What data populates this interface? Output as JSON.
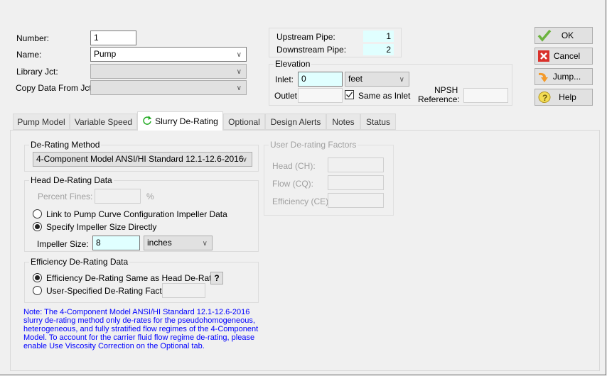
{
  "header": {
    "number_label": "Number:",
    "number_value": "1",
    "name_label": "Name:",
    "name_value": "Pump",
    "library_label": "Library Jct:",
    "copy_label": "Copy Data From Jct..."
  },
  "pipes": {
    "upstream_label": "Upstream Pipe:",
    "upstream_value": "1",
    "downstream_label": "Downstream Pipe:",
    "downstream_value": "2"
  },
  "elevation": {
    "title": "Elevation",
    "inlet_label": "Inlet:",
    "inlet_value": "0",
    "unit": "feet",
    "outlet_label": "Outlet:",
    "same_label": "Same as Inlet",
    "same_checked": true,
    "npsh_label1": "NPSH",
    "npsh_label2": "Reference:"
  },
  "buttons": {
    "ok": "OK",
    "cancel": "Cancel",
    "jump": "Jump...",
    "help": "Help"
  },
  "tabs": [
    {
      "label": "Pump Model"
    },
    {
      "label": "Variable Speed"
    },
    {
      "label": "Slurry De-Rating",
      "active": true
    },
    {
      "label": "Optional"
    },
    {
      "label": "Design Alerts"
    },
    {
      "label": "Notes"
    },
    {
      "label": "Status"
    }
  ],
  "derating": {
    "method_title": "De-Rating Method",
    "method_value": "4-Component Model ANSI/HI Standard 12.1-12.6-2016",
    "head_title": "Head De-Rating Data",
    "percent_fines_label": "Percent Fines:",
    "percent_unit": "%",
    "link_label": "Link to Pump Curve Configuration Impeller Data",
    "specify_label": "Specify Impeller Size Directly",
    "selected": "specify",
    "impeller_label": "Impeller Size:",
    "impeller_value": "8",
    "impeller_unit": "inches",
    "eff_title": "Efficiency De-Rating Data",
    "eff_same_label": "Efficiency De-Rating Same as Head De-Rating",
    "eff_user_label": "User-Specified De-Rating Factor",
    "eff_selected": "same",
    "help_q": "?"
  },
  "user_factors": {
    "title": "User De-rating Factors",
    "head_label": "Head (CH):",
    "flow_label": "Flow (CQ):",
    "eff_label": "Efficiency (CE):"
  },
  "note": "Note: The 4-Component Model ANSI/HI Standard 12.1-12.6-2016 slurry de-rating method only de-rates for the pseudohomogeneous, heterogeneous, and fully stratified flow regimes of the 4-Component Model. To account for the carrier fluid flow regime de-rating, please enable Use Viscosity Correction on the Optional tab.",
  "colors": {
    "note": "#0000ff",
    "input_highlight": "#e0ffff",
    "tab_icon": "#22aa22"
  }
}
